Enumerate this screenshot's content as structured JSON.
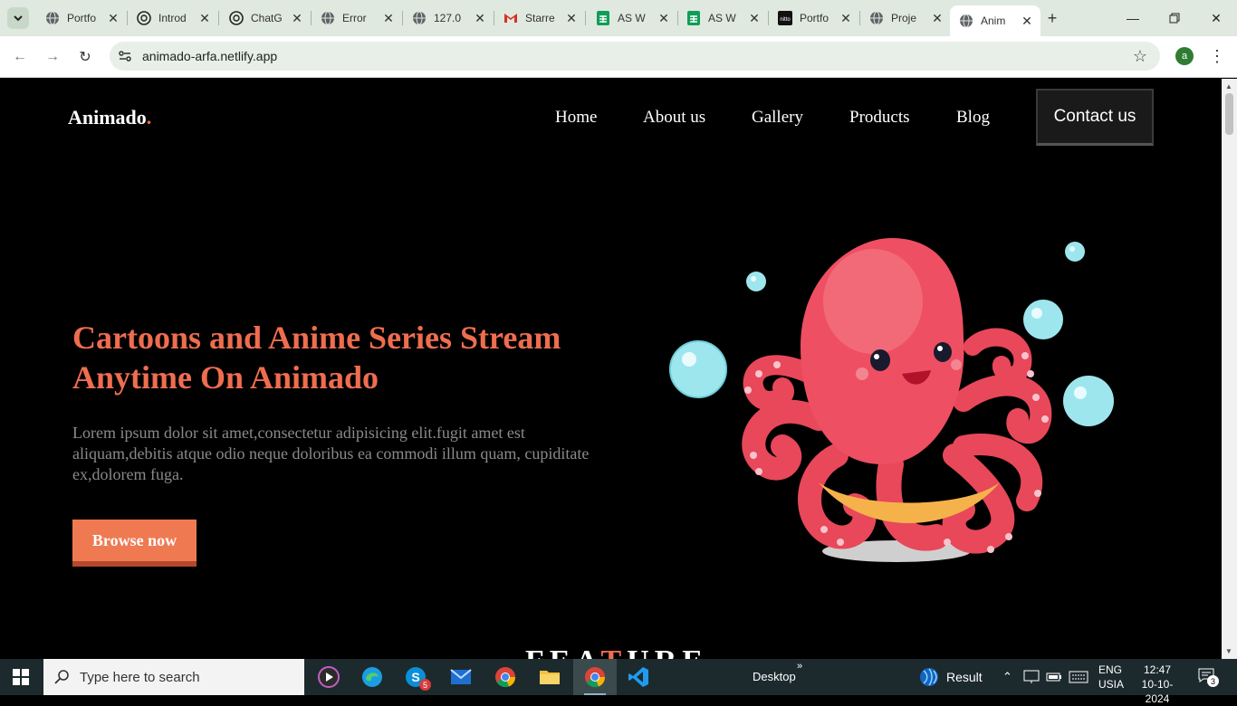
{
  "browser": {
    "tabs": [
      {
        "label": "Portfo",
        "icon": "globe-icon"
      },
      {
        "label": "Introd",
        "icon": "openai-icon"
      },
      {
        "label": "ChatG",
        "icon": "openai-icon"
      },
      {
        "label": "Error",
        "icon": "globe-icon"
      },
      {
        "label": "127.0",
        "icon": "globe-icon"
      },
      {
        "label": "Starre",
        "icon": "gmail-icon"
      },
      {
        "label": "AS W",
        "icon": "sheets-icon"
      },
      {
        "label": "AS W",
        "icon": "sheets-icon"
      },
      {
        "label": "Portfo",
        "icon": "nitto-icon"
      },
      {
        "label": "Proje",
        "icon": "globe-icon"
      },
      {
        "label": "Anim",
        "icon": "globe-icon"
      }
    ],
    "url": "animado-arfa.netlify.app",
    "profile_initial": "a"
  },
  "site": {
    "logo_text": "Animado",
    "logo_dot": ".",
    "nav": [
      "Home",
      "About us",
      "Gallery",
      "Products",
      "Blog"
    ],
    "contact_label": "Contact us",
    "hero_title": "Cartoons and Anime Series Stream Anytime On Animado",
    "hero_text": "Lorem ipsum dolor sit amet,consectetur adipisicing elit.fugit amet est aliquam,debitis atque odio neque doloribus ea commodi illum quam, cupiditate ex,dolorem fuga.",
    "browse_label": "Browse now",
    "feature_prefix": "FEA",
    "feature_highlight": "T",
    "feature_suffix": "URE",
    "colors": {
      "accent": "#ef6d4f",
      "background": "#000000",
      "button": "#ef7a52"
    }
  },
  "taskbar": {
    "search_placeholder": "Type here to search",
    "desktop_label": "Desktop",
    "weather_label": "Result",
    "lang_line1": "ENG",
    "lang_line2": "USIA",
    "time": "12:47",
    "date": "10-10-2024",
    "notification_count": "3",
    "skype_badge": "5"
  }
}
